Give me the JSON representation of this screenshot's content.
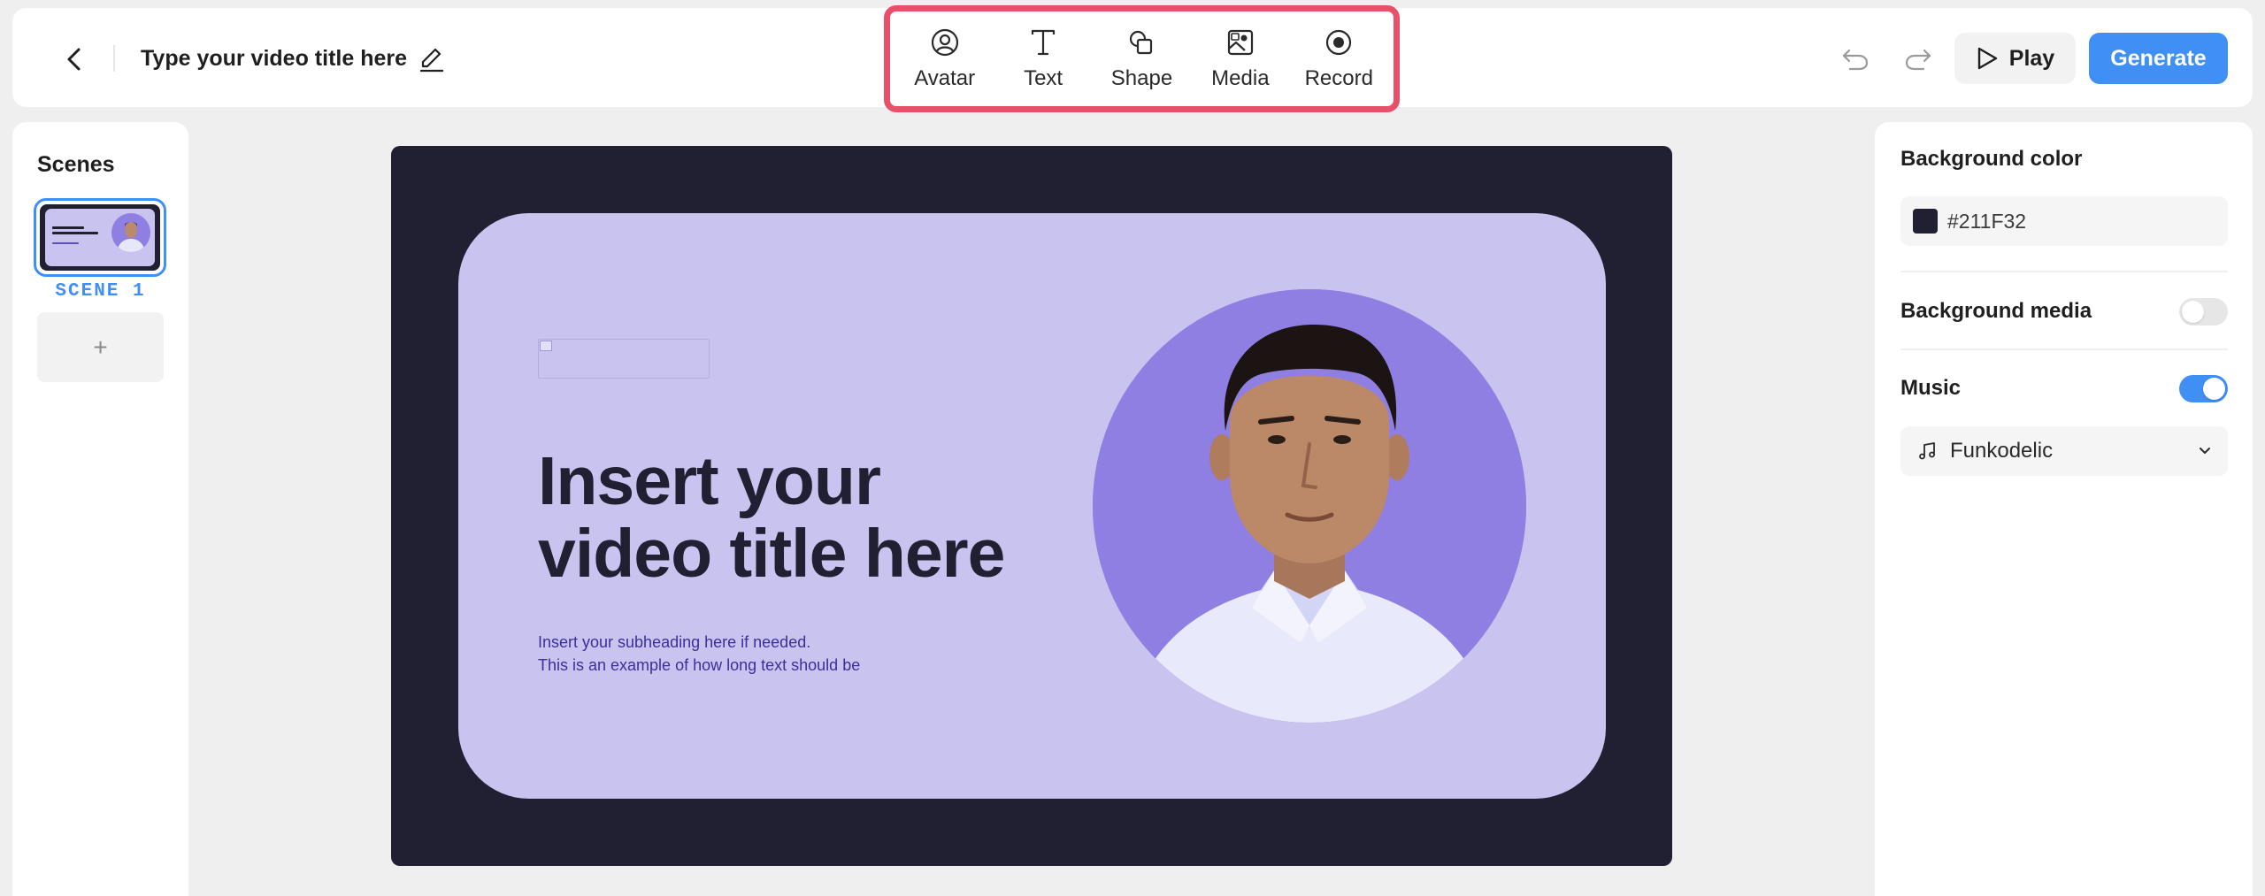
{
  "header": {
    "video_title": "Type your video title here",
    "tools": [
      {
        "label": "Avatar",
        "icon": "avatar-icon"
      },
      {
        "label": "Text",
        "icon": "text-icon"
      },
      {
        "label": "Shape",
        "icon": "shape-icon"
      },
      {
        "label": "Media",
        "icon": "media-icon"
      },
      {
        "label": "Record",
        "icon": "record-icon"
      }
    ],
    "play_label": "Play",
    "generate_label": "Generate"
  },
  "scenes": {
    "title": "Scenes",
    "items": [
      {
        "label": "SCENE 1",
        "selected": true
      }
    ],
    "add_label": "+"
  },
  "canvas": {
    "headline_line1": "Insert your",
    "headline_line2": "video title here",
    "subheading_line1": "Insert your subheading here if needed.",
    "subheading_line2": "This is an example of how long text should be"
  },
  "properties": {
    "background_color_label": "Background color",
    "background_color_value": "#211F32",
    "background_media_label": "Background media",
    "background_media_enabled": false,
    "music_label": "Music",
    "music_enabled": true,
    "music_track": "Funkodelic"
  },
  "colors": {
    "accent": "#3f8ff5",
    "toolbar_highlight": "#e8506a",
    "canvas_background": "#211F32",
    "card_background": "#c8c4ef",
    "avatar_circle": "#8f7fe3"
  }
}
